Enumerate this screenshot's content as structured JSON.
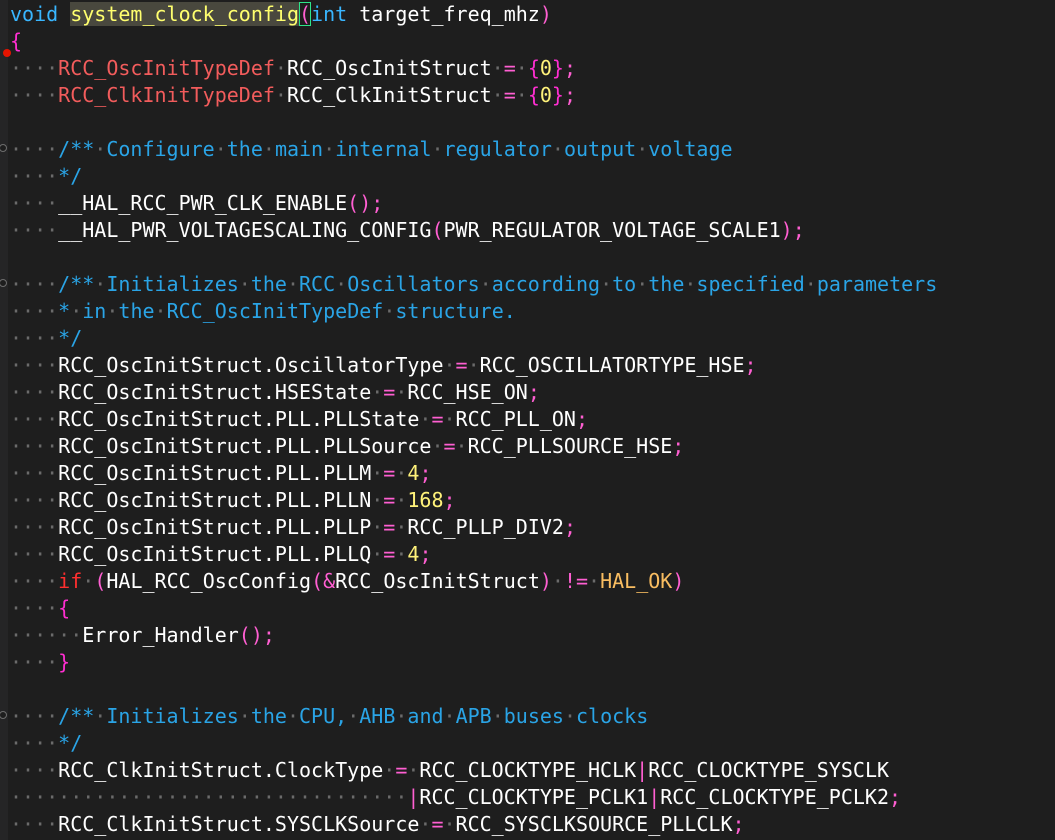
{
  "colors": {
    "background": "#1e1e1e",
    "dot": "#6b6b6b",
    "text": "#ffffff",
    "keyword": "#ff2f2f",
    "type": "#f25c5c",
    "paren": "#ff5fd2",
    "brace": "#ff2ed1",
    "number": "#fff27a",
    "comment": "#2aa4e6",
    "funcname": "#ffff6e",
    "macro_const": "#ffffff",
    "param_type": "#39b6ff",
    "hal_ok": "#f9bd61"
  },
  "lines": [
    {
      "fold": false,
      "bp": false,
      "tokens": [
        {
          "t": "void",
          "c": "param_type"
        },
        {
          "t": "·",
          "c": "dot_nbsp"
        },
        {
          "t": "system_clock_config",
          "c": "funcname",
          "hl": true
        },
        {
          "t": "(",
          "c": "paren",
          "box": true
        },
        {
          "t": "int",
          "c": "param_type"
        },
        {
          "t": "·",
          "c": "dot_nbsp"
        },
        {
          "t": "target_freq_mhz",
          "c": "text"
        },
        {
          "t": ")",
          "c": "paren"
        }
      ]
    },
    {
      "fold": false,
      "bp": false,
      "tokens": [
        {
          "t": "{",
          "c": "brace"
        }
      ]
    },
    {
      "fold": false,
      "bp": true,
      "tokens": [
        {
          "t": "····",
          "c": "dot"
        },
        {
          "t": "RCC_OscInitTypeDef",
          "c": "type"
        },
        {
          "t": "·",
          "c": "dot"
        },
        {
          "t": "RCC_OscInitStruct",
          "c": "text"
        },
        {
          "t": "·",
          "c": "dot"
        },
        {
          "t": "=",
          "c": "paren"
        },
        {
          "t": "·",
          "c": "dot"
        },
        {
          "t": "{",
          "c": "brace"
        },
        {
          "t": "0",
          "c": "number"
        },
        {
          "t": "}",
          "c": "brace"
        },
        {
          "t": ";",
          "c": "paren"
        }
      ]
    },
    {
      "fold": false,
      "bp": false,
      "tokens": [
        {
          "t": "····",
          "c": "dot"
        },
        {
          "t": "RCC_ClkInitTypeDef",
          "c": "type"
        },
        {
          "t": "·",
          "c": "dot"
        },
        {
          "t": "RCC_ClkInitStruct",
          "c": "text"
        },
        {
          "t": "·",
          "c": "dot"
        },
        {
          "t": "=",
          "c": "paren"
        },
        {
          "t": "·",
          "c": "dot"
        },
        {
          "t": "{",
          "c": "brace"
        },
        {
          "t": "0",
          "c": "number"
        },
        {
          "t": "}",
          "c": "brace"
        },
        {
          "t": ";",
          "c": "paren"
        }
      ]
    },
    {
      "fold": false,
      "bp": false,
      "tokens": []
    },
    {
      "fold": true,
      "bp": false,
      "tokens": [
        {
          "t": "····",
          "c": "dot"
        },
        {
          "t": "/**",
          "c": "comment"
        },
        {
          "t": "·",
          "c": "dot"
        },
        {
          "t": "Configure",
          "c": "comment"
        },
        {
          "t": "·",
          "c": "dot"
        },
        {
          "t": "the",
          "c": "comment"
        },
        {
          "t": "·",
          "c": "dot"
        },
        {
          "t": "main",
          "c": "comment"
        },
        {
          "t": "·",
          "c": "dot"
        },
        {
          "t": "internal",
          "c": "comment"
        },
        {
          "t": "·",
          "c": "dot"
        },
        {
          "t": "regulator",
          "c": "comment"
        },
        {
          "t": "·",
          "c": "dot"
        },
        {
          "t": "output",
          "c": "comment"
        },
        {
          "t": "·",
          "c": "dot"
        },
        {
          "t": "voltage",
          "c": "comment"
        }
      ]
    },
    {
      "fold": false,
      "bp": false,
      "tokens": [
        {
          "t": "····",
          "c": "dot"
        },
        {
          "t": "*/",
          "c": "comment"
        }
      ]
    },
    {
      "fold": false,
      "bp": false,
      "tokens": [
        {
          "t": "····",
          "c": "dot"
        },
        {
          "t": "__HAL_RCC_PWR_CLK_ENABLE",
          "c": "text"
        },
        {
          "t": "()",
          "c": "paren"
        },
        {
          "t": ";",
          "c": "paren"
        }
      ]
    },
    {
      "fold": false,
      "bp": false,
      "tokens": [
        {
          "t": "····",
          "c": "dot"
        },
        {
          "t": "__HAL_PWR_VOLTAGESCALING_CONFIG",
          "c": "text"
        },
        {
          "t": "(",
          "c": "paren"
        },
        {
          "t": "PWR_REGULATOR_VOLTAGE_SCALE1",
          "c": "text"
        },
        {
          "t": ")",
          "c": "paren"
        },
        {
          "t": ";",
          "c": "paren"
        }
      ]
    },
    {
      "fold": false,
      "bp": false,
      "tokens": []
    },
    {
      "fold": true,
      "bp": false,
      "tokens": [
        {
          "t": "····",
          "c": "dot"
        },
        {
          "t": "/**",
          "c": "comment"
        },
        {
          "t": "·",
          "c": "dot"
        },
        {
          "t": "Initializes",
          "c": "comment"
        },
        {
          "t": "·",
          "c": "dot"
        },
        {
          "t": "the",
          "c": "comment"
        },
        {
          "t": "·",
          "c": "dot"
        },
        {
          "t": "RCC",
          "c": "comment"
        },
        {
          "t": "·",
          "c": "dot"
        },
        {
          "t": "Oscillators",
          "c": "comment"
        },
        {
          "t": "·",
          "c": "dot"
        },
        {
          "t": "according",
          "c": "comment"
        },
        {
          "t": "·",
          "c": "dot"
        },
        {
          "t": "to",
          "c": "comment"
        },
        {
          "t": "·",
          "c": "dot"
        },
        {
          "t": "the",
          "c": "comment"
        },
        {
          "t": "·",
          "c": "dot"
        },
        {
          "t": "specified",
          "c": "comment"
        },
        {
          "t": "·",
          "c": "dot"
        },
        {
          "t": "parameters",
          "c": "comment"
        }
      ]
    },
    {
      "fold": false,
      "bp": false,
      "tokens": [
        {
          "t": "····",
          "c": "dot"
        },
        {
          "t": "*",
          "c": "comment"
        },
        {
          "t": "·",
          "c": "dot"
        },
        {
          "t": "in",
          "c": "comment"
        },
        {
          "t": "·",
          "c": "dot"
        },
        {
          "t": "the",
          "c": "comment"
        },
        {
          "t": "·",
          "c": "dot"
        },
        {
          "t": "RCC_OscInitTypeDef",
          "c": "comment"
        },
        {
          "t": "·",
          "c": "dot"
        },
        {
          "t": "structure.",
          "c": "comment"
        }
      ]
    },
    {
      "fold": false,
      "bp": false,
      "tokens": [
        {
          "t": "····",
          "c": "dot"
        },
        {
          "t": "*/",
          "c": "comment"
        }
      ]
    },
    {
      "fold": false,
      "bp": false,
      "tokens": [
        {
          "t": "····",
          "c": "dot"
        },
        {
          "t": "RCC_OscInitStruct.OscillatorType",
          "c": "text"
        },
        {
          "t": "·",
          "c": "dot"
        },
        {
          "t": "=",
          "c": "paren"
        },
        {
          "t": "·",
          "c": "dot"
        },
        {
          "t": "RCC_OSCILLATORTYPE_HSE",
          "c": "text"
        },
        {
          "t": ";",
          "c": "paren"
        }
      ]
    },
    {
      "fold": false,
      "bp": false,
      "tokens": [
        {
          "t": "····",
          "c": "dot"
        },
        {
          "t": "RCC_OscInitStruct.HSEState",
          "c": "text"
        },
        {
          "t": "·",
          "c": "dot"
        },
        {
          "t": "=",
          "c": "paren"
        },
        {
          "t": "·",
          "c": "dot"
        },
        {
          "t": "RCC_HSE_ON",
          "c": "text"
        },
        {
          "t": ";",
          "c": "paren"
        }
      ]
    },
    {
      "fold": false,
      "bp": false,
      "tokens": [
        {
          "t": "····",
          "c": "dot"
        },
        {
          "t": "RCC_OscInitStruct.PLL.PLLState",
          "c": "text"
        },
        {
          "t": "·",
          "c": "dot"
        },
        {
          "t": "=",
          "c": "paren"
        },
        {
          "t": "·",
          "c": "dot"
        },
        {
          "t": "RCC_PLL_ON",
          "c": "text"
        },
        {
          "t": ";",
          "c": "paren"
        }
      ]
    },
    {
      "fold": false,
      "bp": false,
      "tokens": [
        {
          "t": "····",
          "c": "dot"
        },
        {
          "t": "RCC_OscInitStruct.PLL.PLLSource",
          "c": "text"
        },
        {
          "t": "·",
          "c": "dot"
        },
        {
          "t": "=",
          "c": "paren"
        },
        {
          "t": "·",
          "c": "dot"
        },
        {
          "t": "RCC_PLLSOURCE_HSE",
          "c": "text"
        },
        {
          "t": ";",
          "c": "paren"
        }
      ]
    },
    {
      "fold": false,
      "bp": false,
      "tokens": [
        {
          "t": "····",
          "c": "dot"
        },
        {
          "t": "RCC_OscInitStruct.PLL.PLLM",
          "c": "text"
        },
        {
          "t": "·",
          "c": "dot"
        },
        {
          "t": "=",
          "c": "paren"
        },
        {
          "t": "·",
          "c": "dot"
        },
        {
          "t": "4",
          "c": "number"
        },
        {
          "t": ";",
          "c": "paren"
        }
      ]
    },
    {
      "fold": false,
      "bp": false,
      "tokens": [
        {
          "t": "····",
          "c": "dot"
        },
        {
          "t": "RCC_OscInitStruct.PLL.PLLN",
          "c": "text"
        },
        {
          "t": "·",
          "c": "dot"
        },
        {
          "t": "=",
          "c": "paren"
        },
        {
          "t": "·",
          "c": "dot"
        },
        {
          "t": "168",
          "c": "number"
        },
        {
          "t": ";",
          "c": "paren"
        }
      ]
    },
    {
      "fold": false,
      "bp": false,
      "tokens": [
        {
          "t": "····",
          "c": "dot"
        },
        {
          "t": "RCC_OscInitStruct.PLL.PLLP",
          "c": "text"
        },
        {
          "t": "·",
          "c": "dot"
        },
        {
          "t": "=",
          "c": "paren"
        },
        {
          "t": "·",
          "c": "dot"
        },
        {
          "t": "RCC_PLLP_DIV2",
          "c": "text"
        },
        {
          "t": ";",
          "c": "paren"
        }
      ]
    },
    {
      "fold": false,
      "bp": false,
      "tokens": [
        {
          "t": "····",
          "c": "dot"
        },
        {
          "t": "RCC_OscInitStruct.PLL.PLLQ",
          "c": "text"
        },
        {
          "t": "·",
          "c": "dot"
        },
        {
          "t": "=",
          "c": "paren"
        },
        {
          "t": "·",
          "c": "dot"
        },
        {
          "t": "4",
          "c": "number"
        },
        {
          "t": ";",
          "c": "paren"
        }
      ]
    },
    {
      "fold": false,
      "bp": false,
      "tokens": [
        {
          "t": "····",
          "c": "dot"
        },
        {
          "t": "if",
          "c": "keyword"
        },
        {
          "t": "·",
          "c": "dot"
        },
        {
          "t": "(",
          "c": "paren"
        },
        {
          "t": "HAL_RCC_OscConfig",
          "c": "text"
        },
        {
          "t": "(&",
          "c": "paren"
        },
        {
          "t": "RCC_OscInitStruct",
          "c": "text"
        },
        {
          "t": ")",
          "c": "paren"
        },
        {
          "t": "·",
          "c": "dot"
        },
        {
          "t": "!=",
          "c": "paren"
        },
        {
          "t": "·",
          "c": "dot"
        },
        {
          "t": "HAL_OK",
          "c": "hal_ok"
        },
        {
          "t": ")",
          "c": "paren"
        }
      ]
    },
    {
      "fold": false,
      "bp": false,
      "tokens": [
        {
          "t": "····",
          "c": "dot"
        },
        {
          "t": "{",
          "c": "brace"
        }
      ]
    },
    {
      "fold": false,
      "bp": false,
      "tokens": [
        {
          "t": "······",
          "c": "dot"
        },
        {
          "t": "Error_Handler",
          "c": "text"
        },
        {
          "t": "()",
          "c": "paren"
        },
        {
          "t": ";",
          "c": "paren"
        }
      ]
    },
    {
      "fold": false,
      "bp": false,
      "tokens": [
        {
          "t": "····",
          "c": "dot"
        },
        {
          "t": "}",
          "c": "brace"
        }
      ]
    },
    {
      "fold": false,
      "bp": false,
      "tokens": []
    },
    {
      "fold": true,
      "bp": false,
      "tokens": [
        {
          "t": "····",
          "c": "dot"
        },
        {
          "t": "/**",
          "c": "comment"
        },
        {
          "t": "·",
          "c": "dot"
        },
        {
          "t": "Initializes",
          "c": "comment"
        },
        {
          "t": "·",
          "c": "dot"
        },
        {
          "t": "the",
          "c": "comment"
        },
        {
          "t": "·",
          "c": "dot"
        },
        {
          "t": "CPU,",
          "c": "comment"
        },
        {
          "t": "·",
          "c": "dot"
        },
        {
          "t": "AHB",
          "c": "comment"
        },
        {
          "t": "·",
          "c": "dot"
        },
        {
          "t": "and",
          "c": "comment"
        },
        {
          "t": "·",
          "c": "dot"
        },
        {
          "t": "APB",
          "c": "comment"
        },
        {
          "t": "·",
          "c": "dot"
        },
        {
          "t": "buses",
          "c": "comment"
        },
        {
          "t": "·",
          "c": "dot"
        },
        {
          "t": "clocks",
          "c": "comment"
        }
      ]
    },
    {
      "fold": false,
      "bp": false,
      "tokens": [
        {
          "t": "····",
          "c": "dot"
        },
        {
          "t": "*/",
          "c": "comment"
        }
      ]
    },
    {
      "fold": false,
      "bp": false,
      "tokens": [
        {
          "t": "····",
          "c": "dot"
        },
        {
          "t": "RCC_ClkInitStruct.ClockType",
          "c": "text"
        },
        {
          "t": "·",
          "c": "dot"
        },
        {
          "t": "=",
          "c": "paren"
        },
        {
          "t": "·",
          "c": "dot"
        },
        {
          "t": "RCC_CLOCKTYPE_HCLK",
          "c": "text"
        },
        {
          "t": "|",
          "c": "paren"
        },
        {
          "t": "RCC_CLOCKTYPE_SYSCLK",
          "c": "text"
        }
      ]
    },
    {
      "fold": false,
      "bp": false,
      "tokens": [
        {
          "t": "·································",
          "c": "dot"
        },
        {
          "t": "|",
          "c": "paren"
        },
        {
          "t": "RCC_CLOCKTYPE_PCLK1",
          "c": "text"
        },
        {
          "t": "|",
          "c": "paren"
        },
        {
          "t": "RCC_CLOCKTYPE_PCLK2",
          "c": "text"
        },
        {
          "t": ";",
          "c": "paren"
        }
      ]
    },
    {
      "fold": false,
      "bp": false,
      "tokens": [
        {
          "t": "····",
          "c": "dot"
        },
        {
          "t": "RCC_ClkInitStruct.SYSCLKSource",
          "c": "text"
        },
        {
          "t": "·",
          "c": "dot"
        },
        {
          "t": "=",
          "c": "paren"
        },
        {
          "t": "·",
          "c": "dot"
        },
        {
          "t": "RCC_SYSCLKSOURCE_PLLCLK",
          "c": "text"
        },
        {
          "t": ";",
          "c": "paren"
        }
      ]
    }
  ]
}
